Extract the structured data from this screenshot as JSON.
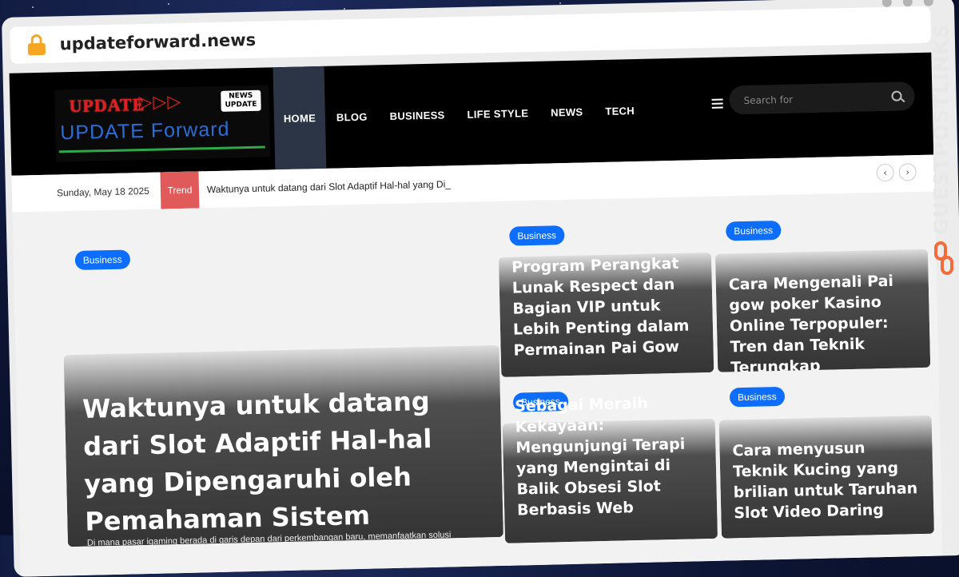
{
  "browser": {
    "url": "updateforward.news"
  },
  "site": {
    "logo": {
      "line1": "UPDATE",
      "line2": "UPDATE Forward",
      "badge_line1": "NEWS",
      "badge_line2": "UPDATE"
    },
    "nav": [
      {
        "label": "HOME",
        "active": true
      },
      {
        "label": "BLOG",
        "active": false
      },
      {
        "label": "BUSINESS",
        "active": false
      },
      {
        "label": "LIFE STYLE",
        "active": false
      },
      {
        "label": "NEWS",
        "active": false
      },
      {
        "label": "TECH",
        "active": false
      }
    ],
    "search": {
      "placeholder": "Search for"
    },
    "trendbar": {
      "date": "Sunday, May 18 2025",
      "badge": "Trend",
      "headline": "Waktunya untuk datang dari Slot Adaptif Hal-hal yang Di_",
      "prev": "‹",
      "next": "›"
    },
    "cards": [
      {
        "category": "Business",
        "title": "Waktunya untuk datang dari Slot Adaptif Hal-hal yang Dipengaruhi oleh Pemahaman Sistem",
        "desc": "Di mana pasar igaming berada di garis depan dari perkembangan baru, memanfaatkan solusi"
      },
      {
        "category": "Business",
        "title": "Program Perangkat Lunak Respect dan Bagian VIP untuk Lebih Penting dalam Permainan Pai Gow"
      },
      {
        "category": "Business",
        "title": "Cara Mengenali Pai gow poker Kasino Online Terpopuler: Tren dan Teknik Terungkap"
      },
      {
        "category": "Business",
        "title": "Sebagai Meraih Kekayaan: Mengunjungi Terapi yang Mengintai di Balik Obsesi Slot Berbasis Web"
      },
      {
        "category": "Business",
        "title": "Cara menyusun Teknik Kucing yang brilian untuk Taruhan Slot Video Daring"
      }
    ]
  },
  "watermark": {
    "text": "GUESTPOSTLINKS"
  },
  "colors": {
    "accent": "#0d6efd",
    "trend": "#e05a5a",
    "header": "#000000",
    "watermark_icon": "#f26b3a"
  }
}
